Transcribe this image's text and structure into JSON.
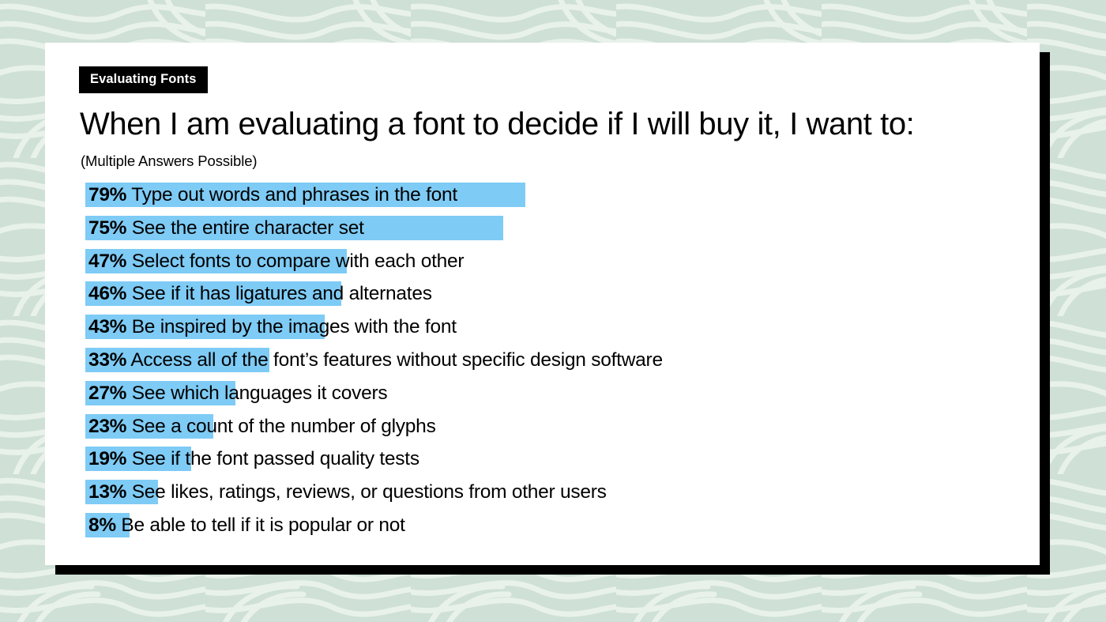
{
  "background": {
    "base_color": "#cfe0d6",
    "line_color": "#e8f2ea",
    "pattern_name": "organic-wave-pattern"
  },
  "slide": {
    "card_color": "#ffffff",
    "shadow_color": "#000000",
    "eyebrow": "Evaluating Fonts",
    "headline": "When I am evaluating a font to decide if I will buy it, I want to:",
    "subtitle": "(Multiple Answers Possible)",
    "highlight_color": "#7ecbf5"
  },
  "chart_data": {
    "type": "bar",
    "title": "When I am evaluating a font to decide if I will buy it, I want to:",
    "subtitle": "(Multiple Answers Possible)",
    "orientation": "horizontal",
    "xlabel": "",
    "ylabel": "",
    "xlim": [
      0,
      100
    ],
    "grid": false,
    "legend": null,
    "value_suffix": "%",
    "categories": [
      "Type out words and phrases in the font",
      "See the entire character set",
      "Select fonts to compare with each other",
      "See if it has ligatures and alternates",
      "Be inspired by the images with the font",
      "Access all of the font’s features without specific design software",
      "See which languages it covers",
      "See a count of the number of glyphs",
      "See if the font passed quality tests",
      "See likes, ratings, reviews, or questions from other users",
      "Be able to tell if it is popular or not"
    ],
    "values": [
      79,
      75,
      47,
      46,
      43,
      33,
      27,
      23,
      19,
      13,
      8
    ],
    "rows": [
      {
        "pct": "79%",
        "value": 79,
        "label": "Type out words and phrases in the font"
      },
      {
        "pct": "75%",
        "value": 75,
        "label": "See the entire character set"
      },
      {
        "pct": "47%",
        "value": 47,
        "label": "Select fonts to compare with each other"
      },
      {
        "pct": "46%",
        "value": 46,
        "label": "See if it has ligatures and alternates"
      },
      {
        "pct": "43%",
        "value": 43,
        "label": "Be inspired by the images with the font"
      },
      {
        "pct": "33%",
        "value": 33,
        "label": "Access all of the font’s features without specific design software"
      },
      {
        "pct": "27%",
        "value": 27,
        "label": "See which languages it covers"
      },
      {
        "pct": "23%",
        "value": 23,
        "label": "See a count of the number of glyphs"
      },
      {
        "pct": "19%",
        "value": 19,
        "label": "See if the font passed quality tests"
      },
      {
        "pct": "13%",
        "value": 13,
        "label": "See likes, ratings, reviews, or questions from other users"
      },
      {
        "pct": "8%",
        "value": 8,
        "label": "Be able to tell if it is popular or not"
      }
    ]
  }
}
